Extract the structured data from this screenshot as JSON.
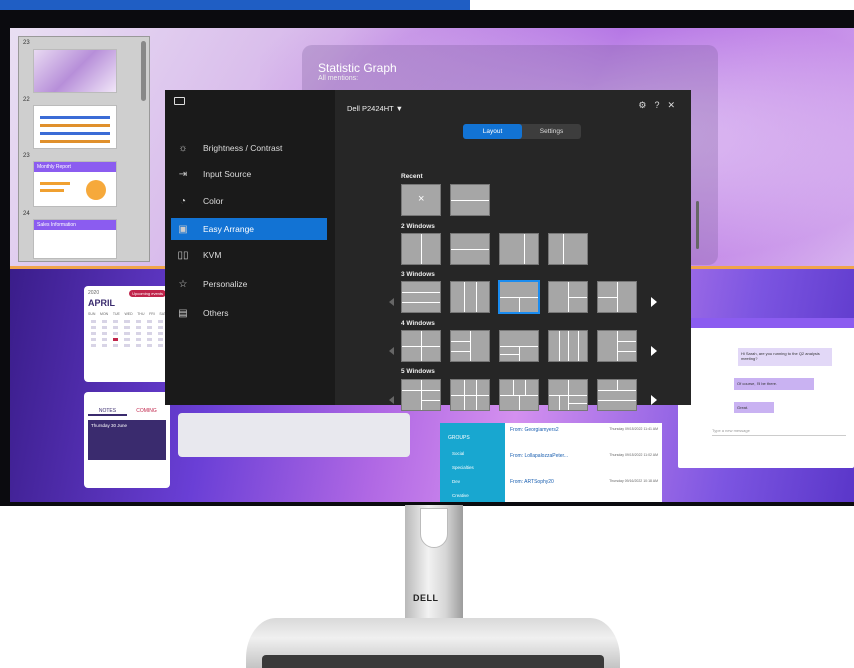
{
  "ddm": {
    "model": "Dell P2424HT ▼",
    "tabs": [
      {
        "label": "Layout",
        "active": true
      },
      {
        "label": "Settings",
        "active": false
      }
    ],
    "menu": [
      {
        "icon": "brightness-icon",
        "glyph": "☼",
        "label": "Brightness / Contrast"
      },
      {
        "icon": "input-source-icon",
        "glyph": "⇥",
        "label": "Input Source"
      },
      {
        "icon": "color-icon",
        "glyph": "◔",
        "label": "Color"
      },
      {
        "icon": "easy-arrange-icon",
        "glyph": "▣",
        "label": "Easy Arrange",
        "active": true
      },
      {
        "icon": "kvm-icon",
        "glyph": "▯▯",
        "label": "KVM"
      },
      {
        "icon": "personalize-icon",
        "glyph": "☆",
        "label": "Personalize"
      },
      {
        "icon": "others-icon",
        "glyph": "▤",
        "label": "Others"
      }
    ],
    "sections": {
      "recent": "Recent",
      "two": "2 Windows",
      "three": "3 Windows",
      "four": "4 Windows",
      "five": "5 Windows"
    },
    "recent_close": "×",
    "window_controls": [
      "⚙",
      "?",
      "✕"
    ]
  },
  "stat": {
    "title": "Statistic Graph",
    "subtitle": "All mentions:"
  },
  "slides": [
    {
      "num": "23"
    },
    {
      "num": "22"
    },
    {
      "num": "23",
      "title": "Monthly Report"
    },
    {
      "num": "24",
      "title": "Sales Information"
    }
  ],
  "calendar": {
    "year": "2020",
    "month": "APRIL",
    "badge": "Upcoming events",
    "days": [
      "SUN",
      "MON",
      "TUE",
      "WED",
      "THU",
      "FRI",
      "SAT"
    ]
  },
  "notes": {
    "tabs": [
      "NOTES",
      "COMING"
    ],
    "date": "Thursday 30 June"
  },
  "chat": {
    "msg1": "Hi Sarah, are you running to the Q2 analysis meeting?",
    "msg2": "Of course, I'll be there.",
    "msg3": "Great.",
    "input": "Type a new message"
  },
  "mail": {
    "groups": "GROUPS",
    "side": [
      "Social",
      "Specialties",
      "Dev",
      "Creative"
    ],
    "items": [
      {
        "from": "From: Georgiamyers2",
        "date": "Thursday 09/15/2022 11:41 AM"
      },
      {
        "from": "From: LollapalozzaPeter...",
        "date": "Thursday 09/15/2022 11:02 AM"
      },
      {
        "from": "From: ARTSophy20",
        "date": "Thursday 09/16/2022 10:18 AM"
      }
    ]
  },
  "brand": "DELL",
  "colors": {
    "accent": "#1273d4",
    "panel": "#262626",
    "sidebar": "#1a1a1a",
    "selection": "#1a8cf0"
  }
}
